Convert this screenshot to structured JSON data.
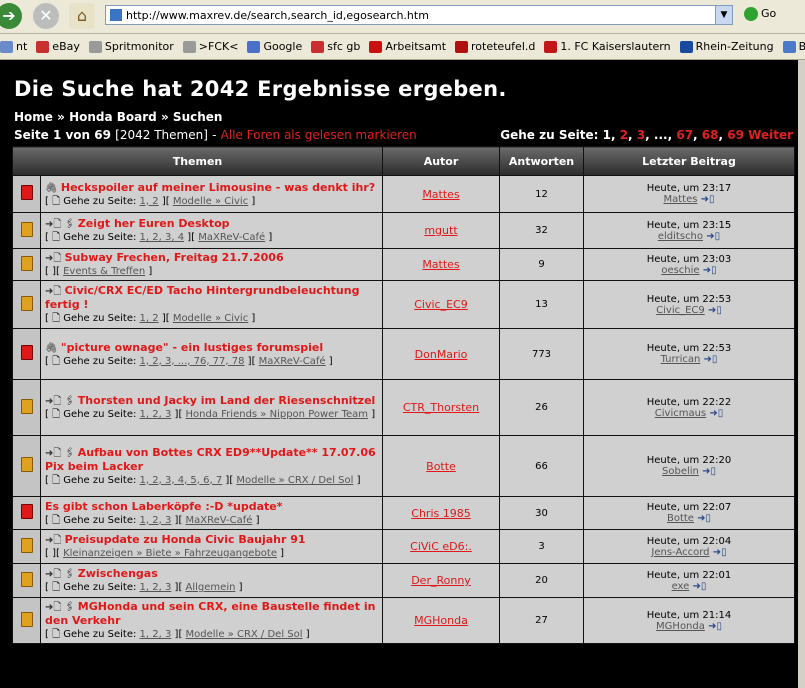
{
  "browser": {
    "url": "http://www.maxrev.de/search,search_id,egosearch.htm",
    "go_label": "Go",
    "bookmarks": [
      {
        "label": "nt",
        "icon": "page-icon",
        "color": "#6a8ac8"
      },
      {
        "label": "eBay",
        "icon": "ebay-icon",
        "color": "#c83030"
      },
      {
        "label": "Spritmonitor",
        "icon": "page-icon",
        "color": "#9a9a9a"
      },
      {
        "label": ">FCK<",
        "icon": "page-icon",
        "color": "#9a9a9a"
      },
      {
        "label": "Google",
        "icon": "google-icon",
        "color": "#4a70c8"
      },
      {
        "label": "sfc gb",
        "icon": "ebay-icon",
        "color": "#c83030"
      },
      {
        "label": "Arbeitsamt",
        "icon": "arbeitsamt-icon",
        "color": "#cc1010"
      },
      {
        "label": "roteteufel.d",
        "icon": "devil-icon",
        "color": "#b01010"
      },
      {
        "label": "1. FC Kaiserslautern",
        "icon": "fck-icon",
        "color": "#c01818"
      },
      {
        "label": "Rhein-Zeitung",
        "icon": "rz-icon",
        "color": "#1a4aa0"
      },
      {
        "label": "Bank",
        "icon": "bank-icon",
        "color": "#4a7ac8"
      }
    ]
  },
  "page": {
    "heading": "Die Suche hat 2042 Ergebnisse ergeben.",
    "breadcrumb": {
      "home": "Home",
      "sep": "»",
      "board": "Honda Board",
      "search": "Suchen"
    },
    "page_info": {
      "prefix": "Seite 1 von 69",
      "count": "[2042 Themen]",
      "dash": "-",
      "mark_read": "Alle Foren als gelesen markieren"
    },
    "goto": {
      "label": "Gehe zu Seite:",
      "p1": "1",
      "p2": "2",
      "p3": "3",
      "dots": "...",
      "p67": "67",
      "p68": "68",
      "p69": "69",
      "next": "Weiter"
    }
  },
  "table": {
    "headers": {
      "topic": "Themen",
      "author": "Autor",
      "answers": "Antworten",
      "last": "Letzter Beitrag"
    },
    "rows": [
      {
        "hot": true,
        "marks": "🖇",
        "title": "Heckspoiler auf meiner Limousine - was denkt ihr?",
        "sub_prefix": "[ 🗋 Gehe zu Seite:",
        "pages": "1, 2",
        "forum": "Modelle » Civic",
        "author": "Mattes",
        "answers": "12",
        "time": "Heute, um 23:17",
        "last_user": "Mattes"
      },
      {
        "hot": false,
        "marks": "➜🗋 🖇",
        "title": "Zeigt her Euren Desktop",
        "sub_prefix": "[ 🗋 Gehe zu Seite:",
        "pages": "1, 2, 3, 4",
        "forum": "MaXReV-Café",
        "author": "mgutt",
        "answers": "32",
        "time": "Heute, um 23:15",
        "last_user": "elditscho"
      },
      {
        "hot": false,
        "marks": "➜🗋",
        "title": "Subway Frechen, Freitag 21.7.2006",
        "sub_prefix": "[",
        "pages": "",
        "forum": "Events & Treffen",
        "author": "Mattes",
        "answers": "9",
        "time": "Heute, um 23:03",
        "last_user": "oeschie"
      },
      {
        "hot": false,
        "marks": "➜🗋",
        "title": "Civic/CRX EC/ED Tacho Hintergrundbeleuchtung fertig !",
        "sub_prefix": "[ 🗋 Gehe zu Seite:",
        "pages": "1, 2",
        "forum": "Modelle » Civic",
        "author": "Civic_EC9",
        "answers": "13",
        "time": "Heute, um 22:53",
        "last_user": "Civic_EC9"
      },
      {
        "hot": true,
        "marks": "🖇",
        "title": "\"picture ownage\" - ein lustiges forumspiel",
        "sub_prefix": "[ 🗋 Gehe zu Seite:",
        "pages": "1, 2, 3, ..., 76, 77, 78",
        "forum": "MaXReV-Café",
        "author": "DonMario",
        "answers": "773",
        "time": "Heute, um 22:53",
        "last_user": "Turrican"
      },
      {
        "hot": false,
        "marks": "➜🗋 🖇",
        "title": "Thorsten und Jacky im Land der Riesenschnitzel",
        "sub_prefix": "[ 🗋 Gehe zu Seite:",
        "pages": "1, 2, 3",
        "forum": "Honda Friends » Nippon Power Team",
        "author": "CTR_Thorsten",
        "answers": "26",
        "time": "Heute, um 22:22",
        "last_user": "Civicmaus"
      },
      {
        "hot": false,
        "marks": "➜🗋 🖇",
        "title": "Aufbau von Bottes CRX ED9**Update** 17.07.06 Pix beim Lacker",
        "sub_prefix": "[ 🗋 Gehe zu Seite:",
        "pages": "1, 2, 3, 4, 5, 6, 7",
        "forum": "Modelle » CRX / Del Sol",
        "author": "Botte",
        "answers": "66",
        "time": "Heute, um 22:20",
        "last_user": "Sobelin"
      },
      {
        "hot": true,
        "marks": "",
        "title": "Es gibt schon Laberköpfe :-D *update*",
        "sub_prefix": "[ 🗋 Gehe zu Seite:",
        "pages": "1, 2, 3",
        "forum": "MaXReV-Café",
        "author": "Chris 1985",
        "answers": "30",
        "time": "Heute, um 22:07",
        "last_user": "Botte"
      },
      {
        "hot": false,
        "marks": "➜🗋",
        "title": "Preisupdate zu Honda Civic Baujahr 91",
        "sub_prefix": "[",
        "pages": "",
        "forum": "Kleinanzeigen » Biete » Fahrzeugangebote",
        "author": "CiViC eD6:.",
        "answers": "3",
        "time": "Heute, um 22:04",
        "last_user": "Jens-Accord"
      },
      {
        "hot": false,
        "marks": "➜🗋 🖇",
        "title": "Zwischengas",
        "sub_prefix": "[ 🗋 Gehe zu Seite:",
        "pages": "1, 2, 3",
        "forum": "Allgemein",
        "author": "Der_Ronny",
        "answers": "20",
        "time": "Heute, um 22:01",
        "last_user": "exe"
      },
      {
        "hot": false,
        "marks": "➜🗋 🖇",
        "title": "MGHonda und sein CRX, eine Baustelle findet in den Verkehr",
        "sub_prefix": "[ 🗋 Gehe zu Seite:",
        "pages": "1, 2, 3",
        "forum": "Modelle » CRX / Del Sol",
        "author": "MGHonda",
        "answers": "27",
        "time": "Heute, um 21:14",
        "last_user": "MGHonda"
      }
    ]
  }
}
